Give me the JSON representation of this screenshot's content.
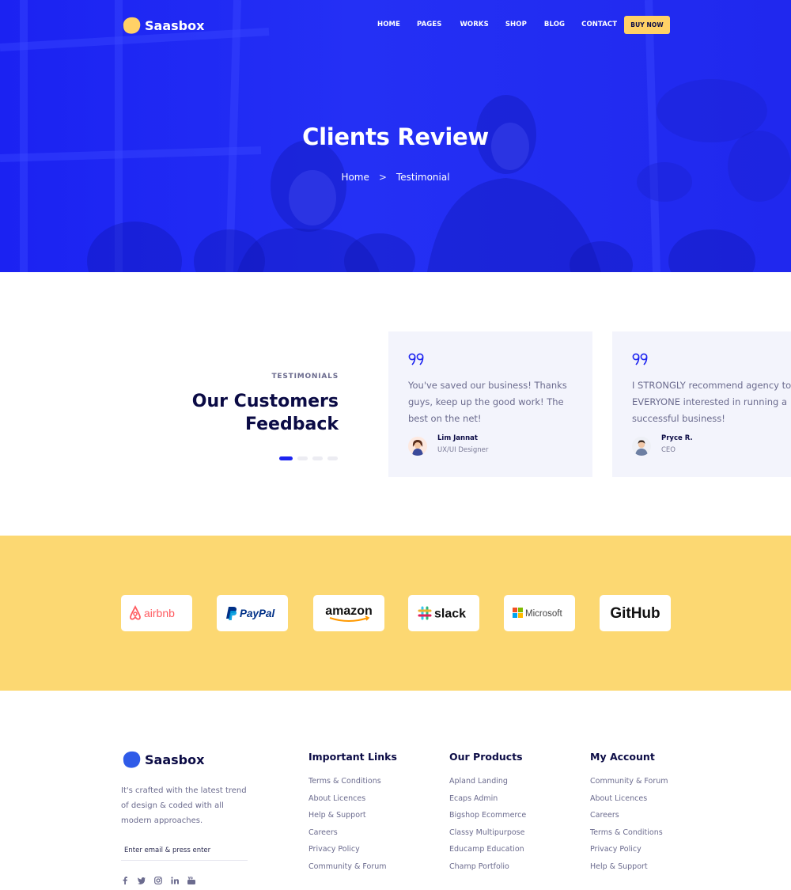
{
  "brand": {
    "name": "Saasbox"
  },
  "nav": {
    "items": [
      "HOME",
      "PAGES",
      "WORKS",
      "SHOP",
      "BLOG",
      "CONTACT"
    ],
    "cta": "BUY NOW"
  },
  "hero": {
    "title": "Clients Review",
    "breadcrumb": {
      "home": "Home",
      "separator": ">",
      "current": "Testimonial"
    }
  },
  "testimonials": {
    "eyebrow": "TESTIMONIALS",
    "heading_line1": "Our Customers",
    "heading_line2": "Feedback",
    "slider": {
      "pages": 4,
      "active_index": 0
    },
    "cards": [
      {
        "text": "You've saved our business! Thanks guys, keep up the good work! The best on the net!",
        "author": "Lim Jannat",
        "role": "UX/UI Designer"
      },
      {
        "text": "I STRONGLY recommend agency to EVERYONE interested in running a successful business!",
        "author": "Pryce R.",
        "role": "CEO"
      }
    ]
  },
  "partners": {
    "logos": [
      {
        "name": "airbnb",
        "color": "#ff5a5f",
        "icon": "airbnb-icon"
      },
      {
        "name": "PayPal",
        "color": "#003087",
        "accent": "#009cde",
        "icon": "paypal-icon"
      },
      {
        "name": "amazon",
        "color": "#111111",
        "accent": "#ff9900"
      },
      {
        "name": "slack",
        "color": "#111111",
        "icon": "slack-icon"
      },
      {
        "name": "Microsoft",
        "color": "#444444",
        "icon": "microsoft-icon"
      },
      {
        "name": "GitHub",
        "color": "#111111"
      }
    ]
  },
  "footer": {
    "about": "It's crafted with the latest trend of design & coded with all modern approaches.",
    "email_placeholder": "Enter email & press enter",
    "socials": [
      "facebook-icon",
      "twitter-icon",
      "instagram-icon",
      "linkedin-icon",
      "youtube-icon"
    ],
    "columns": [
      {
        "title": "Important Links",
        "links": [
          "Terms & Conditions",
          "About Licences",
          "Help & Support",
          "Careers",
          "Privacy Policy",
          "Community & Forum"
        ]
      },
      {
        "title": "Our Products",
        "links": [
          "Apland Landing",
          "Ecaps Admin",
          "Bigshop Ecommerce",
          "Classy Multipurpose",
          "Educamp Education",
          "Champ Portfolio"
        ]
      },
      {
        "title": "My Account",
        "links": [
          "Community & Forum",
          "About Licences",
          "Careers",
          "Terms & Conditions",
          "Privacy Policy",
          "Help & Support"
        ]
      }
    ]
  },
  "colors": {
    "primary": "#1d24f0",
    "accent": "#ffd166",
    "brand_band": "#fcd872",
    "heading": "#0b0b45",
    "body_text": "#6b6b8e",
    "card_bg": "#f3f4fc"
  }
}
